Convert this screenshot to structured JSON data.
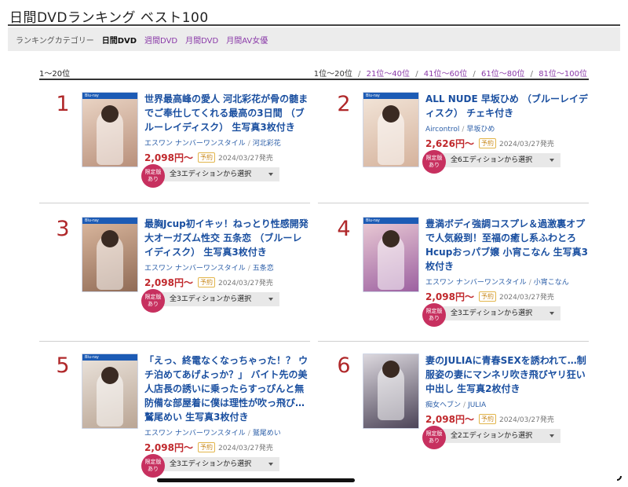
{
  "page": {
    "title": "日間DVDランキング ベスト100"
  },
  "categories": {
    "label": "ランキングカテゴリー",
    "items": [
      {
        "label": "日間DVD",
        "current": true
      },
      {
        "label": "週間DVD",
        "current": false
      },
      {
        "label": "月間DVD",
        "current": false
      },
      {
        "label": "月間AV女優",
        "current": false
      }
    ]
  },
  "range": {
    "current": "1〜20位",
    "nav": [
      {
        "label": "1位〜20位",
        "current": true
      },
      {
        "label": "21位〜40位",
        "current": false
      },
      {
        "label": "41位〜60位",
        "current": false
      },
      {
        "label": "61位〜80位",
        "current": false
      },
      {
        "label": "81位〜100位",
        "current": false
      }
    ],
    "separator": "/"
  },
  "common": {
    "yoyaku": "予約",
    "limited": "限定版\nあり",
    "maker_separator": "/",
    "bluray_tag": "Blu-ray"
  },
  "items": [
    {
      "rank": "1",
      "title": "世界最高峰の愛人 河北彩花が骨の髄までご奉仕してくれる最高の3日間 （ブルーレイディスク） 生写真3枚付き",
      "maker": "エスワン ナンバーワンスタイル",
      "actress": "河北彩花",
      "price": "2,098円〜",
      "date": "2024/03/27発売",
      "edition": "全3エディションから選択",
      "colors": [
        "#e9d3c3",
        "#b88f7a"
      ]
    },
    {
      "rank": "2",
      "title": "ALL NUDE 早坂ひめ （ブルーレイディスク） チェキ付き",
      "maker": "Aircontrol",
      "actress": "早坂ひめ",
      "price": "2,626円〜",
      "date": "2024/03/27発売",
      "edition": "全6エディションから選択",
      "colors": [
        "#f1e3d6",
        "#d5b29c"
      ]
    },
    {
      "rank": "3",
      "title": "最胸Jcup初イキッ！ねっとり性感開発大オーガズム性交 五条恋 （ブルーレイディスク） 生写真3枚付き",
      "maker": "エスワン ナンバーワンスタイル",
      "actress": "五条恋",
      "price": "2,098円〜",
      "date": "2024/03/27発売",
      "edition": "全3エディションから選択",
      "colors": [
        "#d7b49b",
        "#8f6a55"
      ]
    },
    {
      "rank": "4",
      "title": "豊満ボディ強調コスプレ＆過激裏オプで人気殺到！至福の癒し系ふわとろHcupおっパブ嬢 小宵こなん 生写真3枚付き",
      "maker": "エスワン ナンバーワンスタイル",
      "actress": "小宵こなん",
      "price": "2,098円〜",
      "date": "2024/03/27発売",
      "edition": "全3エディションから選択",
      "colors": [
        "#e7c7d3",
        "#9b5fa0"
      ]
    },
    {
      "rank": "5",
      "title": "「えっ、終電なくなっちゃった！？ ウチ泊めてあげよっか？」 バイト先の美人店長の誘いに乗ったらすっぴんと無防備な部屋着に僕は理性が吹っ飛び… 鷲尾めい 生写真3枚付き",
      "maker": "エスワン ナンバーワンスタイル",
      "actress": "鷲尾めい",
      "price": "2,098円〜",
      "date": "2024/03/27発売",
      "edition": "全3エディションから選択",
      "colors": [
        "#e8e0d8",
        "#b9a493"
      ]
    },
    {
      "rank": "6",
      "title": "妻のJULIAに青春SEXを誘われて…制服姿の妻にマンネリ吹き飛びヤリ狂い中出し 生写真2枚付き",
      "maker": "痴女ヘブン",
      "actress": "JULIA",
      "price": "2,098円〜",
      "date": "2024/03/27発売",
      "edition": "全2エディションから選択",
      "colors": [
        "#dcd8de",
        "#4a4256"
      ]
    }
  ]
}
